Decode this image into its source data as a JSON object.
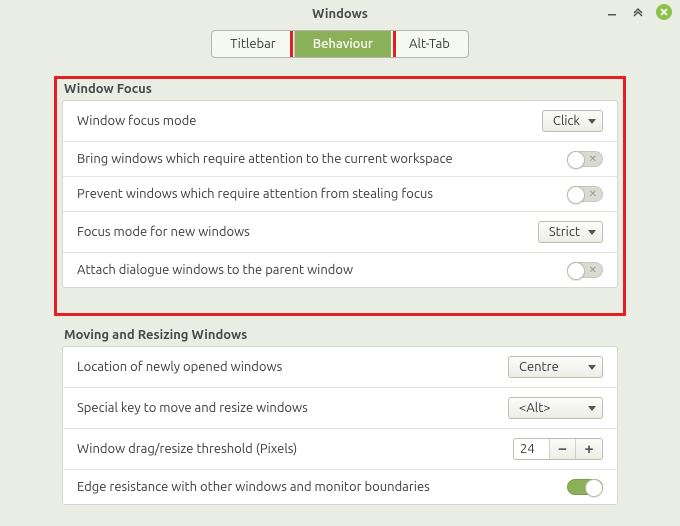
{
  "window": {
    "title": "Windows",
    "tabs": [
      "Titlebar",
      "Behaviour",
      "Alt-Tab"
    ],
    "active_tab": "Behaviour"
  },
  "sections": {
    "window_focus": {
      "title": "Window Focus",
      "rows": {
        "focus_mode": {
          "label": "Window focus mode",
          "value": "Click"
        },
        "bring_attention": {
          "label": "Bring windows which require attention to the current workspace",
          "value": false
        },
        "prevent_stealing": {
          "label": "Prevent windows which require attention from stealing focus",
          "value": false
        },
        "new_focus_mode": {
          "label": "Focus mode for new windows",
          "value": "Strict"
        },
        "attach_dialogs": {
          "label": "Attach dialogue windows to the parent window",
          "value": false
        }
      }
    },
    "moving_resizing": {
      "title": "Moving and Resizing Windows",
      "rows": {
        "location_new": {
          "label": "Location of newly opened windows",
          "value": "Centre"
        },
        "special_key": {
          "label": "Special key to move and resize windows",
          "value": "<Alt>"
        },
        "drag_threshold": {
          "label": "Window drag/resize threshold (Pixels)",
          "value": "24"
        },
        "edge_resistance": {
          "label": "Edge resistance with other windows and monitor boundaries",
          "value": true
        }
      }
    }
  }
}
